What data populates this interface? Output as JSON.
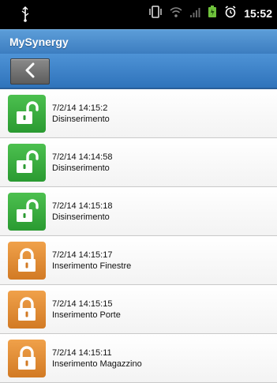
{
  "status_bar": {
    "time": "15:52",
    "icons": [
      "usb-icon",
      "vibrate-icon",
      "wifi-icon",
      "signal-icon",
      "battery-icon",
      "alarm-icon"
    ]
  },
  "app": {
    "title": "MySynergy"
  },
  "toolbar": {
    "back_icon": "chevron-left-icon"
  },
  "events": [
    {
      "time": "7/2/14 14:15:2",
      "text": "Disinserimento",
      "state": "unlocked",
      "color": "#3aaf3e"
    },
    {
      "time": "7/2/14 14:14:58",
      "text": "Disinserimento",
      "state": "unlocked",
      "color": "#3aaf3e"
    },
    {
      "time": "7/2/14 14:15:18",
      "text": "Disinserimento",
      "state": "unlocked",
      "color": "#3aaf3e"
    },
    {
      "time": "7/2/14 14:15:17",
      "text": "Inserimento Finestre",
      "state": "locked",
      "color": "#e28d36"
    },
    {
      "time": "7/2/14 14:15:15",
      "text": "Inserimento Porte",
      "state": "locked",
      "color": "#e28d36"
    },
    {
      "time": "7/2/14 14:15:11",
      "text": "Inserimento Magazzino",
      "state": "locked",
      "color": "#e28d36"
    }
  ]
}
